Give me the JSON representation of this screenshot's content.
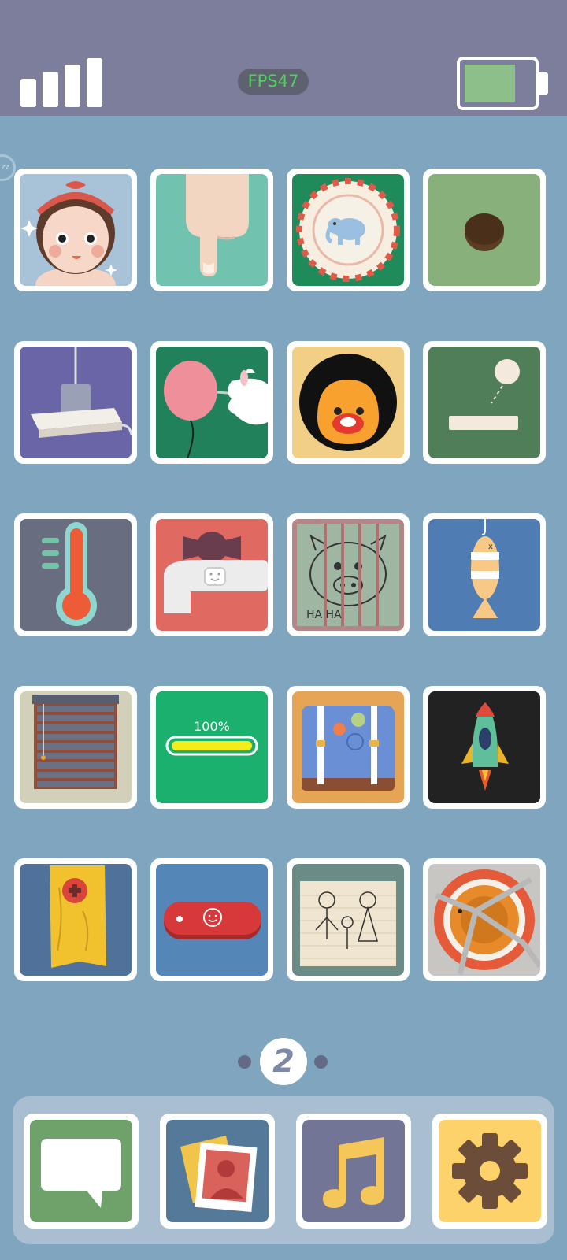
{
  "status_bar": {
    "fps_label": "FPS47",
    "signal_bars": 4,
    "battery_level": 0.7
  },
  "tiles": {
    "row1": [
      "girl-face-icon",
      "pointing-finger-icon",
      "elephant-plate-icon",
      "hole-icon"
    ],
    "row2": [
      "power-plug-icon",
      "balloon-needle-icon",
      "afro-face-icon",
      "pinball-paddle-icon"
    ],
    "row3": [
      "thermometer-icon",
      "water-faucet-icon",
      "caged-pig-drawing-icon",
      "hanging-fish-icon"
    ],
    "row4": [
      "window-blinds-icon",
      "charging-bar-icon",
      "suitcase-icon",
      "rocket-icon"
    ],
    "row5": [
      "wooden-plank-icon",
      "pocket-knife-icon",
      "family-drawing-icon",
      "cracked-shield-icon"
    ]
  },
  "tile_text": {
    "battery_percent": "100%",
    "cage_text": "HA HA"
  },
  "pager": {
    "current_page": "2"
  },
  "dock": {
    "apps": [
      "chat-bubble-icon",
      "photos-icon",
      "music-note-icon",
      "settings-gear-icon"
    ]
  },
  "colors": {
    "background": "#7fa5bf",
    "status_bar": "#7d7e9b",
    "fps_text": "#4bd35a",
    "battery_fill": "#8dbf8a",
    "dock": "#a9bfd1"
  }
}
